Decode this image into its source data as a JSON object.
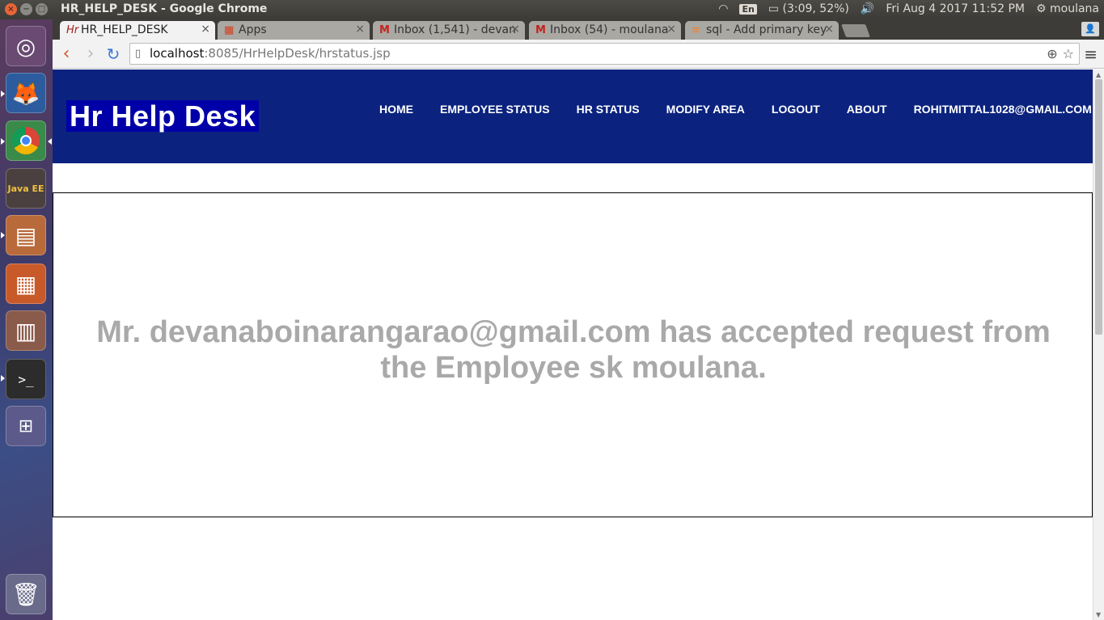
{
  "system": {
    "window_title": "HR_HELP_DESK - Google Chrome",
    "keyboard_layout": "En",
    "battery": "(3:09, 52%)",
    "clock": "Fri Aug  4 2017 11:52 PM",
    "user": "moulana"
  },
  "launcher": {
    "items": [
      {
        "name": "ubuntu-dash-icon",
        "glyph": "◎"
      },
      {
        "name": "firefox-icon",
        "glyph": "🦊"
      },
      {
        "name": "chrome-icon",
        "glyph": "◉"
      },
      {
        "name": "eclipse-javaee-icon",
        "glyph": "⚙"
      },
      {
        "name": "file-manager-icon",
        "glyph": "▤"
      },
      {
        "name": "impress-icon",
        "glyph": "▦"
      },
      {
        "name": "reader-icon",
        "glyph": "📖"
      },
      {
        "name": "terminal-icon",
        "glyph": ">_"
      },
      {
        "name": "workspace-switcher-icon",
        "glyph": "⊞"
      }
    ],
    "trash_glyph": "🗑"
  },
  "browser": {
    "tabs": [
      {
        "label": "HR_HELP_DESK",
        "favicon": "Hr"
      },
      {
        "label": "Apps",
        "favicon": "▦"
      },
      {
        "label": "Inbox (1,541) - devan",
        "favicon": "M"
      },
      {
        "label": "Inbox (54) - moulana",
        "favicon": "M"
      },
      {
        "label": "sql - Add primary key",
        "favicon": "≡"
      }
    ],
    "url_host": "localhost",
    "url_rest": ":8085/HrHelpDesk/hrstatus.jsp"
  },
  "site": {
    "logo": "Hr Help Desk",
    "nav": [
      "HOME",
      "EMPLOYEE STATUS",
      "HR STATUS",
      "MODIFY AREA",
      "LOGOUT",
      "ABOUT",
      "ROHITMITTAL1028@GMAIL.COM"
    ],
    "status_message": "Mr. devanaboinarangarao@gmail.com has accepted request from the Employee sk moulana."
  },
  "colors": {
    "header_bg": "#0b237e",
    "logo_bg": "#0000a8",
    "message_text": "#a9a9a9"
  }
}
